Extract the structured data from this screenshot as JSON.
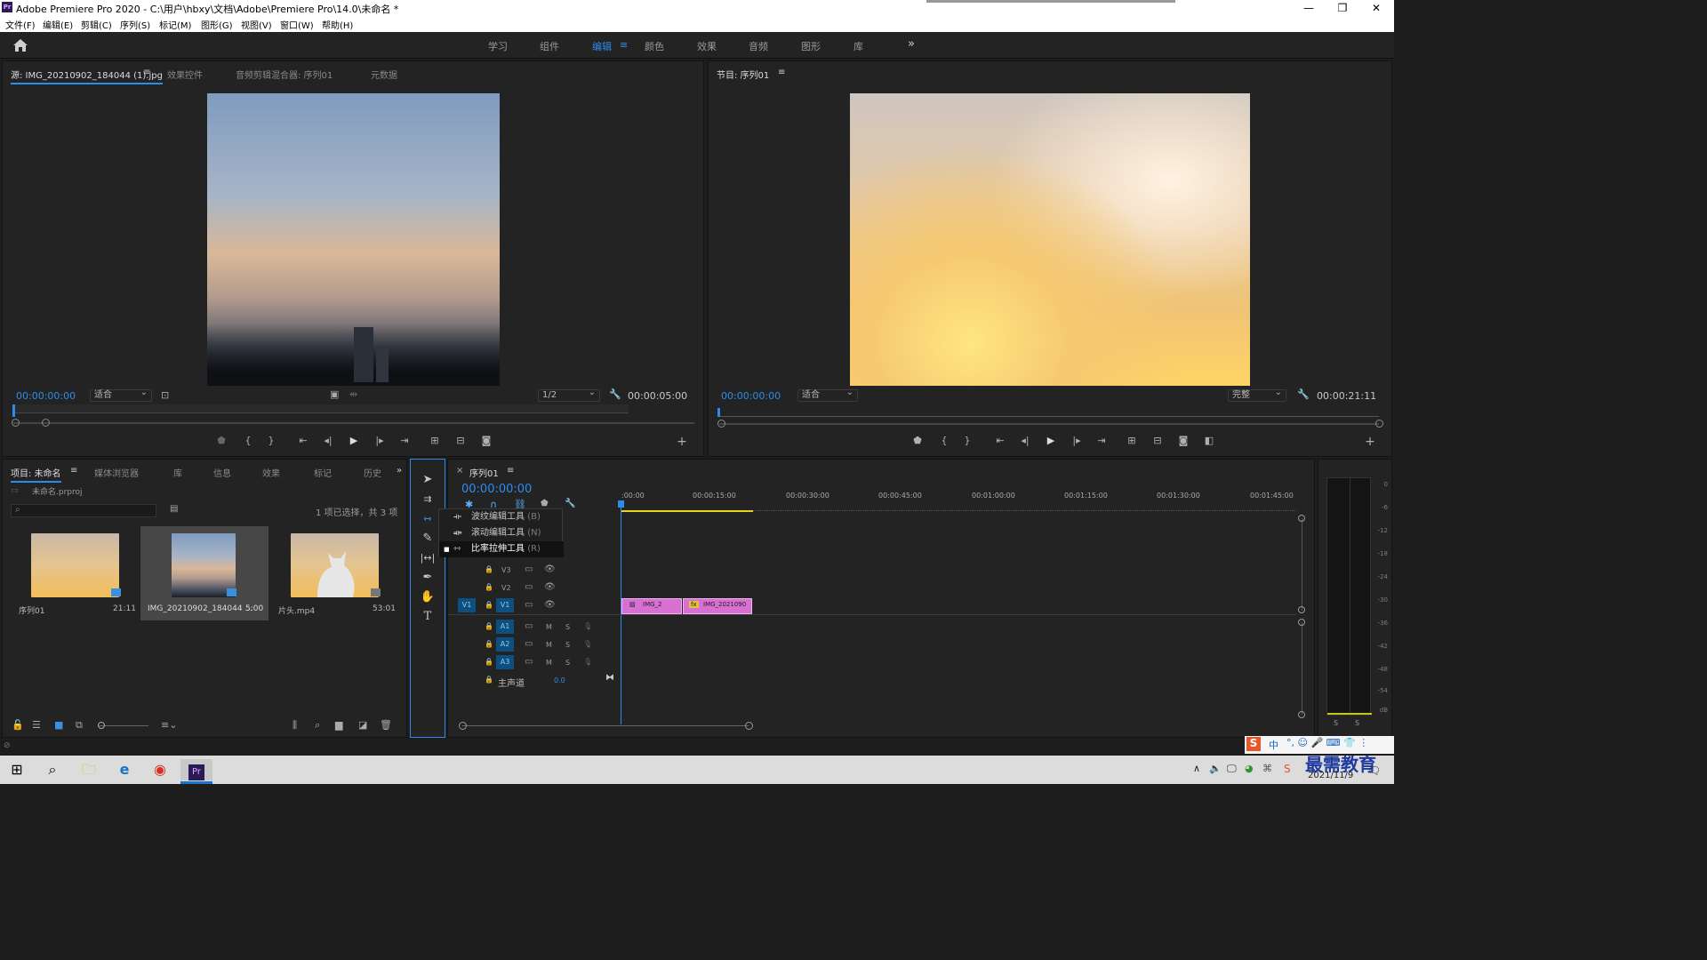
{
  "titlebar": {
    "logo": "Pr",
    "title": "Adobe Premiere Pro 2020 - C:\\用户\\hbxy\\文档\\Adobe\\Premiere Pro\\14.0\\未命名 *",
    "minimize": "—",
    "maximize": "❐",
    "close": "✕"
  },
  "menu": [
    "文件(F)",
    "编辑(E)",
    "剪辑(C)",
    "序列(S)",
    "标记(M)",
    "图形(G)",
    "视图(V)",
    "窗口(W)",
    "帮助(H)"
  ],
  "workspaces": {
    "items": [
      "学习",
      "组件",
      "编辑",
      "颜色",
      "效果",
      "音频",
      "图形",
      "库"
    ],
    "active": "编辑",
    "more": "»"
  },
  "source_panel": {
    "tabs": [
      "源: IMG_20210902_184044 (1).jpg",
      "效果控件",
      "音频剪辑混合器: 序列01",
      "元数据"
    ],
    "timecode_in": "00:00:00:00",
    "fit": "适合",
    "resolution": "1/2",
    "duration": "00:00:05:00"
  },
  "program_panel": {
    "tab": "节目: 序列01",
    "timecode_in": "00:00:00:00",
    "fit": "适合",
    "quality": "完整",
    "duration": "00:00:21:11"
  },
  "project_panel": {
    "tabs": [
      "项目: 未命名",
      "媒体浏览器",
      "库",
      "信息",
      "效果",
      "标记",
      "历史"
    ],
    "project_file": "未命名.prproj",
    "selection_info": "1 项已选择，共 3 项",
    "items": [
      {
        "name": "序列01",
        "duration": "21:11"
      },
      {
        "name": "IMG_20210902_184044 ...",
        "duration": "5:00"
      },
      {
        "name": "片头.mp4",
        "duration": "53:01"
      }
    ]
  },
  "timeline": {
    "tab": "序列01",
    "timecode": "00:00:00:00",
    "ruler": [
      ":00:00",
      "00:00:15:00",
      "00:00:30:00",
      "00:00:45:00",
      "00:01:00:00",
      "00:01:15:00",
      "00:01:30:00",
      "00:01:45:00"
    ],
    "video_tracks": [
      "V3",
      "V2",
      "V1"
    ],
    "audio_tracks": [
      "A1",
      "A2",
      "A3"
    ],
    "source_patch_v": "V1",
    "track_m": "M",
    "track_s": "S",
    "master": {
      "label": "主声道",
      "value": "0.0"
    },
    "clips": [
      {
        "name": "IMG_2",
        "fx": "fx"
      },
      {
        "name": "IMG_2021090",
        "fx": "fx"
      }
    ]
  },
  "tool_menu": {
    "items": [
      {
        "label": "波纹编辑工具",
        "shortcut": "(B)"
      },
      {
        "label": "滚动编辑工具",
        "shortcut": "(N)"
      },
      {
        "label": "比率拉伸工具",
        "shortcut": "(R)",
        "checked": true
      }
    ]
  },
  "audio_meter": {
    "scale": [
      "0",
      "-6",
      "-12",
      "-18",
      "-24",
      "-30",
      "-36",
      "-42",
      "-48",
      "-54",
      "dB"
    ],
    "solo_left": "S",
    "solo_right": "S"
  },
  "taskbar": {
    "date": "2021/11/9",
    "watermark": "最需教育",
    "ime": "中"
  },
  "colors": {
    "accent": "#2d8ceb",
    "clip_pink": "#d86fd3",
    "panel_bg": "#232323"
  }
}
